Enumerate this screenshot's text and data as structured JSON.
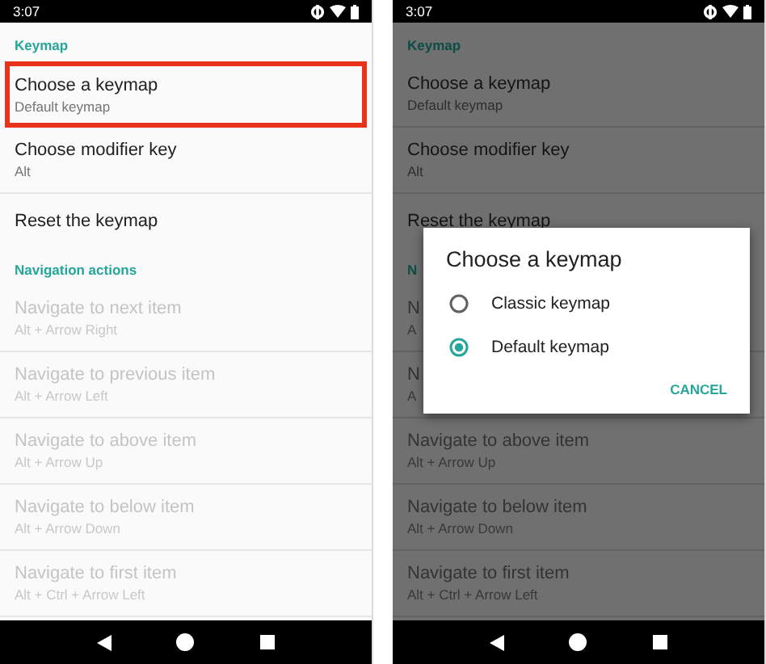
{
  "screens": [
    {
      "status_bar": {
        "time": "3:07"
      },
      "sections": [
        {
          "header": "Keymap",
          "items": [
            {
              "title": "Choose a keymap",
              "summary": "Default keymap",
              "disabled": false,
              "highlighted": true
            },
            {
              "title": "Choose modifier key",
              "summary": "Alt",
              "disabled": false,
              "highlighted": false
            },
            {
              "title": "Reset the keymap",
              "disabled": false,
              "highlighted": false
            }
          ]
        },
        {
          "header": "Navigation actions",
          "items": [
            {
              "title": "Navigate to next item",
              "summary": "Alt + Arrow Right",
              "disabled": true,
              "highlighted": false
            },
            {
              "title": "Navigate to previous item",
              "summary": "Alt + Arrow Left",
              "disabled": true,
              "highlighted": false
            },
            {
              "title": "Navigate to above item",
              "summary": "Alt + Arrow Up",
              "disabled": true,
              "highlighted": false
            },
            {
              "title": "Navigate to below item",
              "summary": "Alt + Arrow Down",
              "disabled": true,
              "highlighted": false
            },
            {
              "title": "Navigate to first item",
              "summary": "Alt + Ctrl + Arrow Left",
              "disabled": true,
              "highlighted": false
            }
          ]
        }
      ]
    },
    {
      "status_bar": {
        "time": "3:07"
      },
      "sections": [
        {
          "header": "Keymap",
          "items": [
            {
              "title": "Choose a keymap",
              "summary": "Default keymap",
              "disabled": false,
              "highlighted": false
            },
            {
              "title": "Choose modifier key",
              "summary": "Alt",
              "disabled": false,
              "highlighted": false
            },
            {
              "title": "Reset the keymap",
              "disabled": false,
              "highlighted": false
            }
          ]
        },
        {
          "header": "N",
          "items": [
            {
              "title": "N",
              "summary": "A",
              "disabled": true,
              "highlighted": false
            },
            {
              "title": "N",
              "summary": "A",
              "disabled": true,
              "highlighted": false
            },
            {
              "title": "Navigate to above item",
              "summary": "Alt + Arrow Up",
              "disabled": true,
              "highlighted": false
            },
            {
              "title": "Navigate to below item",
              "summary": "Alt + Arrow Down",
              "disabled": true,
              "highlighted": false
            },
            {
              "title": "Navigate to first item",
              "summary": "Alt + Ctrl + Arrow Left",
              "disabled": true,
              "highlighted": false
            }
          ]
        }
      ],
      "dialog": {
        "title": "Choose a keymap",
        "options": [
          {
            "label": "Classic keymap",
            "selected": false
          },
          {
            "label": "Default keymap",
            "selected": true
          }
        ],
        "buttons": [
          "CANCEL"
        ]
      }
    }
  ]
}
